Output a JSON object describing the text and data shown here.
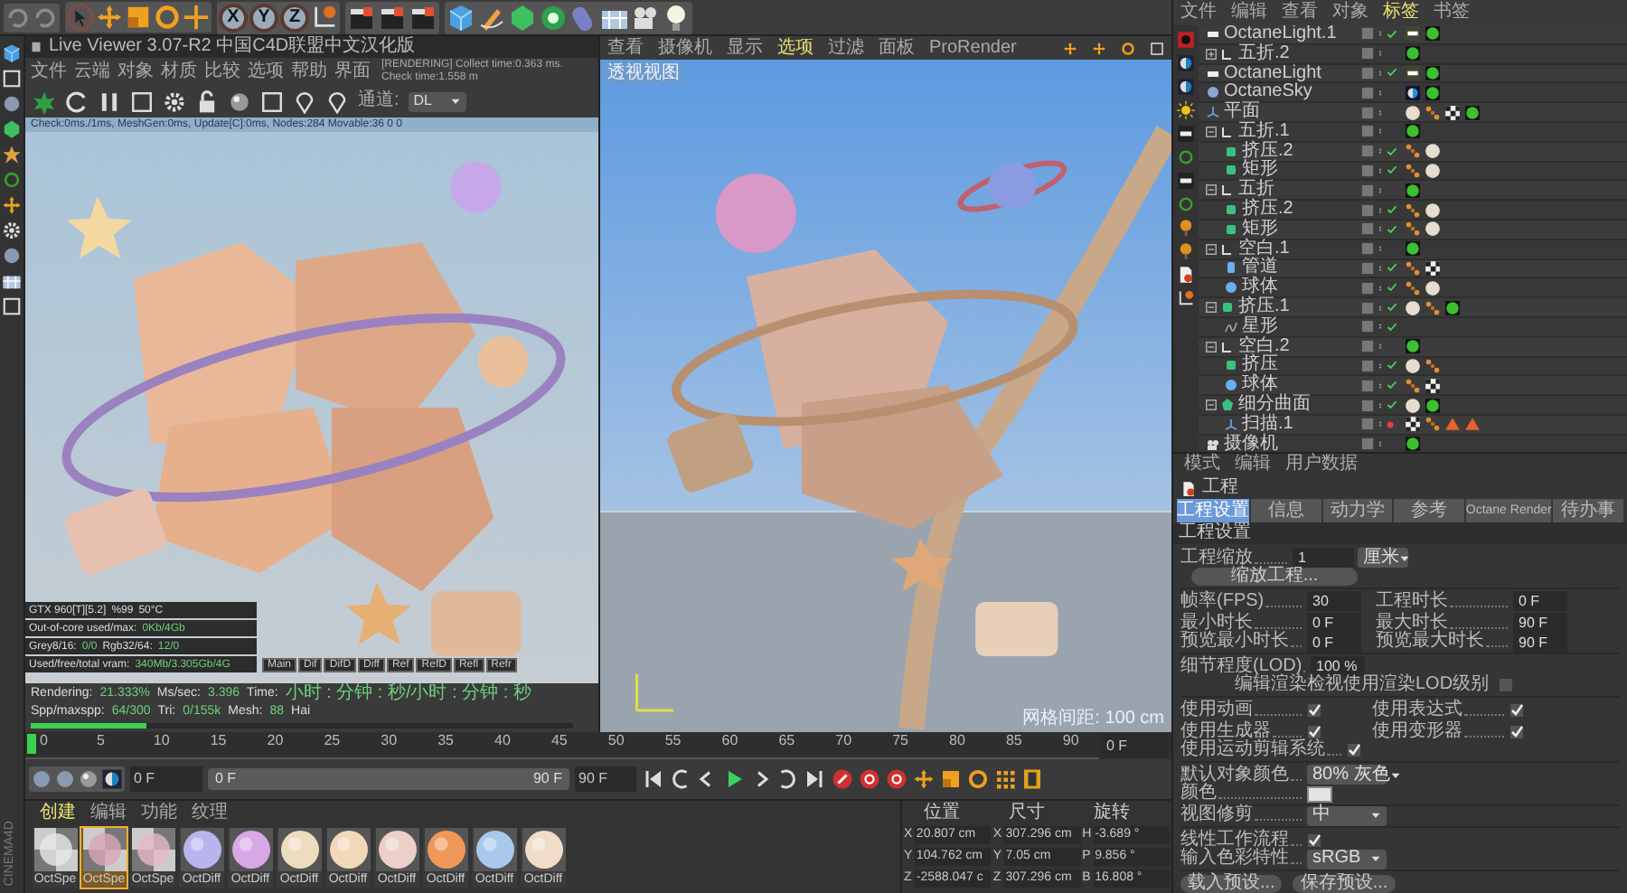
{
  "toolbar": {
    "axis_buttons": [
      "X",
      "Y",
      "Z"
    ]
  },
  "brand": "CINEMA4D",
  "live_viewer": {
    "title": "Live Viewer 3.07-R2 中国C4D联盟中文汉化版",
    "menu": [
      "文件",
      "云端",
      "对象",
      "材质",
      "比较",
      "选项",
      "帮助",
      "界面"
    ],
    "status": "[RENDERING] Collect time:0.363 ms.  Check time:1.558 m",
    "channel_label": "通道:",
    "channel": "DL",
    "scene_info": "Check:0ms./1ms, MeshGen:0ms, Update[C]:0ms, Nodes:284 Movable:36 0 0",
    "stats": [
      {
        "cells": [
          {
            "label": "GTX 960[T][5.2]"
          },
          {
            "label": "%99"
          },
          {
            "label": "50°C"
          }
        ]
      },
      {
        "cells": [
          {
            "label": "Out-of-core used/max:",
            "value": "0Kb/4Gb"
          }
        ]
      },
      {
        "cells": [
          {
            "label": "Grey8/16:",
            "value": "0/0"
          },
          {
            "label": "Rgb32/64:",
            "value": "12/0"
          }
        ]
      },
      {
        "cells": [
          {
            "label": "Used/free/total vram:",
            "value": "340Mb/3.305Gb/4G"
          }
        ]
      }
    ],
    "passes": [
      "Main",
      "Dif",
      "DifD",
      "Diff",
      "Ref",
      "RefD",
      "Refl",
      "Refr"
    ],
    "progress": [
      {
        "label": "Rendering:",
        "value": "21.333%"
      },
      {
        "label": "Ms/sec:",
        "value": "3.396"
      },
      {
        "label": "Time:",
        "value": "小时 : 分钟 : 秒/小时 : 分钟 : 秒"
      },
      {
        "label": "Spp/maxspp:",
        "value": "64/300"
      },
      {
        "label": "Tri:",
        "value": "0/155k"
      },
      {
        "label": "Mesh:",
        "value": "88"
      },
      {
        "label": "Hai"
      }
    ],
    "level": 0.213
  },
  "viewport": {
    "menu": [
      {
        "label": "查看",
        "selected": false
      },
      {
        "label": "摄像机",
        "selected": false
      },
      {
        "label": "显示",
        "selected": false
      },
      {
        "label": "选项",
        "selected": true
      },
      {
        "label": "过滤",
        "selected": false
      },
      {
        "label": "面板",
        "selected": false
      },
      {
        "label": "ProRender",
        "selected": false
      }
    ],
    "view_label": "透视视图",
    "grid_spacing": "网格间距: 100 cm"
  },
  "timeline": {
    "ticks": [
      "0",
      "5",
      "10",
      "15",
      "20",
      "25",
      "30",
      "35",
      "40",
      "45",
      "50",
      "55",
      "60",
      "65",
      "70",
      "75",
      "80",
      "85",
      "90"
    ],
    "frame": "0 F"
  },
  "transport": {
    "start": "0 F",
    "range_start": "0 F",
    "range_end": "90 F",
    "end": "90 F",
    "level": 1
  },
  "materials": {
    "tabs": [
      {
        "label": "创建",
        "selected": true
      },
      {
        "label": "编辑",
        "selected": false
      },
      {
        "label": "功能",
        "selected": false
      },
      {
        "label": "纹理",
        "selected": false
      }
    ],
    "items": [
      {
        "name": "OctSpe",
        "kind": "checker",
        "color": "#e8e8e8",
        "selected": false
      },
      {
        "name": "OctSpe",
        "kind": "checker",
        "color": "#d9a6b8",
        "selected": true
      },
      {
        "name": "OctSpe",
        "kind": "checker",
        "color": "#e6b8c8",
        "selected": false
      },
      {
        "name": "OctDiff",
        "kind": "sphere",
        "color": "#b7b4ee",
        "selected": false
      },
      {
        "name": "OctDiff",
        "kind": "sphere",
        "color": "#d6a8e6",
        "selected": false
      },
      {
        "name": "OctDiff",
        "kind": "sphere",
        "color": "#eedcc0",
        "selected": false
      },
      {
        "name": "OctDiff",
        "kind": "sphere",
        "color": "#f0d8b8",
        "selected": false
      },
      {
        "name": "OctDiff",
        "kind": "sphere",
        "color": "#ecd0c8",
        "selected": false
      },
      {
        "name": "OctDiff",
        "kind": "sphere",
        "color": "#f0985a",
        "selected": false
      },
      {
        "name": "OctDiff",
        "kind": "sphere",
        "color": "#a8c8ec",
        "selected": false
      },
      {
        "name": "OctDiff",
        "kind": "sphere",
        "color": "#f0dcc8",
        "selected": false
      }
    ]
  },
  "coordinates": {
    "headers": [
      "位置",
      "尺寸",
      "旋转"
    ],
    "rows": [
      {
        "axis": "X",
        "position": "20.807 cm",
        "size_axis": "X",
        "size": "307.296 cm",
        "rot_axis": "H",
        "rotation": "-3.689 °"
      },
      {
        "axis": "Y",
        "position": "104.762 cm",
        "size_axis": "Y",
        "size": "7.05 cm",
        "rot_axis": "P",
        "rotation": "9.856 °"
      },
      {
        "axis": "Z",
        "position": "-2588.047 c",
        "size_axis": "Z",
        "size": "307.296 cm",
        "rot_axis": "B",
        "rotation": "16.808 °"
      }
    ]
  },
  "object_manager": {
    "menu": [
      {
        "label": "文件",
        "selected": false
      },
      {
        "label": "编辑",
        "selected": false
      },
      {
        "label": "查看",
        "selected": false
      },
      {
        "label": "对象",
        "selected": false
      },
      {
        "label": "标签",
        "selected": true
      },
      {
        "label": "书签",
        "selected": false
      }
    ],
    "tree": [
      {
        "name": "OctaneLight.1",
        "kind": "light",
        "checked": true,
        "tags": [
          {
            "kind": "light"
          },
          {
            "kind": "octane"
          }
        ]
      },
      {
        "name": "五折.2",
        "kind": "null",
        "checked": false,
        "expanded": false,
        "tags": [
          {
            "kind": "octane"
          }
        ]
      },
      {
        "name": "OctaneLight",
        "kind": "light",
        "checked": true,
        "tags": [
          {
            "kind": "light"
          },
          {
            "kind": "octane"
          }
        ]
      },
      {
        "name": "OctaneSky",
        "kind": "sky",
        "checked": false,
        "tags": [
          {
            "kind": "sky"
          },
          {
            "kind": "octane"
          }
        ]
      },
      {
        "name": "平面",
        "kind": "plane",
        "checked": false,
        "tags": [
          {
            "kind": "material"
          },
          {
            "kind": "phong"
          },
          {
            "kind": "checker"
          },
          {
            "kind": "octane"
          }
        ]
      },
      {
        "name": "五折.1",
        "kind": "null",
        "checked": false,
        "expanded": true,
        "tags": [
          {
            "kind": "octane"
          }
        ],
        "children": [
          {
            "name": "挤压.2",
            "kind": "extrude",
            "checked": true,
            "tags": [
              {
                "kind": "phong"
              },
              {
                "kind": "material"
              }
            ]
          },
          {
            "name": "矩形",
            "kind": "extrude",
            "checked": true,
            "tags": [
              {
                "kind": "phong"
              },
              {
                "kind": "material"
              }
            ]
          }
        ]
      },
      {
        "name": "五折",
        "kind": "null",
        "checked": false,
        "expanded": true,
        "tags": [
          {
            "kind": "octane"
          }
        ],
        "children": [
          {
            "name": "挤压.2",
            "kind": "extrude",
            "checked": true,
            "tags": [
              {
                "kind": "phong"
              },
              {
                "kind": "material"
              }
            ]
          },
          {
            "name": "矩形",
            "kind": "extrude",
            "checked": true,
            "tags": [
              {
                "kind": "phong"
              },
              {
                "kind": "material"
              }
            ]
          }
        ]
      },
      {
        "name": "空白.1",
        "kind": "null",
        "checked": false,
        "expanded": true,
        "tags": [
          {
            "kind": "octane"
          }
        ],
        "children": [
          {
            "name": "管道",
            "kind": "tube",
            "checked": true,
            "tags": [
              {
                "kind": "phong"
              },
              {
                "kind": "checker"
              }
            ]
          },
          {
            "name": "球体",
            "kind": "sphere",
            "checked": true,
            "tags": [
              {
                "kind": "phong"
              },
              {
                "kind": "material"
              }
            ]
          }
        ]
      },
      {
        "name": "挤压.1",
        "kind": "extrude",
        "checked": true,
        "expanded": true,
        "tags": [
          {
            "kind": "material"
          },
          {
            "kind": "phong"
          },
          {
            "kind": "octane"
          }
        ],
        "children": [
          {
            "name": "星形",
            "kind": "spline",
            "checked": true
          }
        ]
      },
      {
        "name": "空白.2",
        "kind": "null",
        "checked": false,
        "expanded": true,
        "tags": [
          {
            "kind": "octane"
          }
        ],
        "children": [
          {
            "name": "挤压",
            "kind": "extrude",
            "checked": true,
            "tags": [
              {
                "kind": "material"
              },
              {
                "kind": "phong"
              }
            ]
          },
          {
            "name": "球体",
            "kind": "sphere",
            "checked": true,
            "tags": [
              {
                "kind": "phong"
              },
              {
                "kind": "checker"
              }
            ]
          }
        ]
      },
      {
        "name": "细分曲面",
        "kind": "subdiv",
        "checked": true,
        "expanded": true,
        "tags": [
          {
            "kind": "material"
          },
          {
            "kind": "octane"
          }
        ],
        "children": [
          {
            "name": "扫描.1",
            "kind": "sweep",
            "checked": false,
            "error": true,
            "tags": [
              {
                "kind": "checker"
              },
              {
                "kind": "phong"
              },
              {
                "kind": "warning"
              },
              {
                "kind": "warning"
              }
            ]
          }
        ]
      },
      {
        "name": "摄像机",
        "kind": "camera",
        "checked": false,
        "tags": [
          {
            "kind": "octane"
          }
        ]
      }
    ]
  },
  "attributes": {
    "menu": [
      "模式",
      "编辑",
      "用户数据"
    ],
    "object": "工程",
    "tabs": [
      {
        "label": "工程设置",
        "selected": true
      },
      {
        "label": "信息",
        "selected": false
      },
      {
        "label": "动力学",
        "selected": false
      },
      {
        "label": "参考",
        "selected": false
      },
      {
        "label": "Octane Render",
        "selected": false
      },
      {
        "label": "待办事",
        "selected": false
      }
    ],
    "section": "工程设置",
    "scale": {
      "label": "工程缩放",
      "value": "1",
      "unit": "厘米"
    },
    "scale_button": "缩放工程...",
    "time_fields": [
      [
        {
          "label": "帧率(FPS)",
          "value": "30"
        },
        {
          "label": "工程时长",
          "value": "0 F"
        }
      ],
      [
        {
          "label": "最小时长",
          "value": "0 F"
        },
        {
          "label": "最大时长",
          "value": "90 F"
        }
      ],
      [
        {
          "label": "预览最小时长",
          "value": "0 F"
        },
        {
          "label": "预览最大时长",
          "value": "90 F"
        }
      ]
    ],
    "lod": {
      "label": "细节程度(LOD)",
      "value": "100 %"
    },
    "render_lod": {
      "label": "编辑渲染检视使用渲染LOD级别",
      "checked": false
    },
    "options": [
      [
        {
          "label": "使用动画",
          "checked": true
        },
        {
          "label": "使用表达式",
          "checked": true
        }
      ],
      [
        {
          "label": "使用生成器",
          "checked": true
        },
        {
          "label": "使用变形器",
          "checked": true
        }
      ],
      [
        {
          "label": "使用运动剪辑系统",
          "checked": true
        }
      ]
    ],
    "default_color": {
      "label": "默认对象颜色",
      "value": "80% 灰色"
    },
    "color": {
      "label": "颜色",
      "color": "#e4e4e4"
    },
    "clipping": {
      "label": "视图修剪",
      "value": "中"
    },
    "linear": {
      "label": "线性工作流程",
      "checked": true
    },
    "input_color": {
      "label": "输入色彩特性",
      "value": "sRGB"
    },
    "buttons": [
      "载入预设...",
      "保存预设..."
    ]
  }
}
